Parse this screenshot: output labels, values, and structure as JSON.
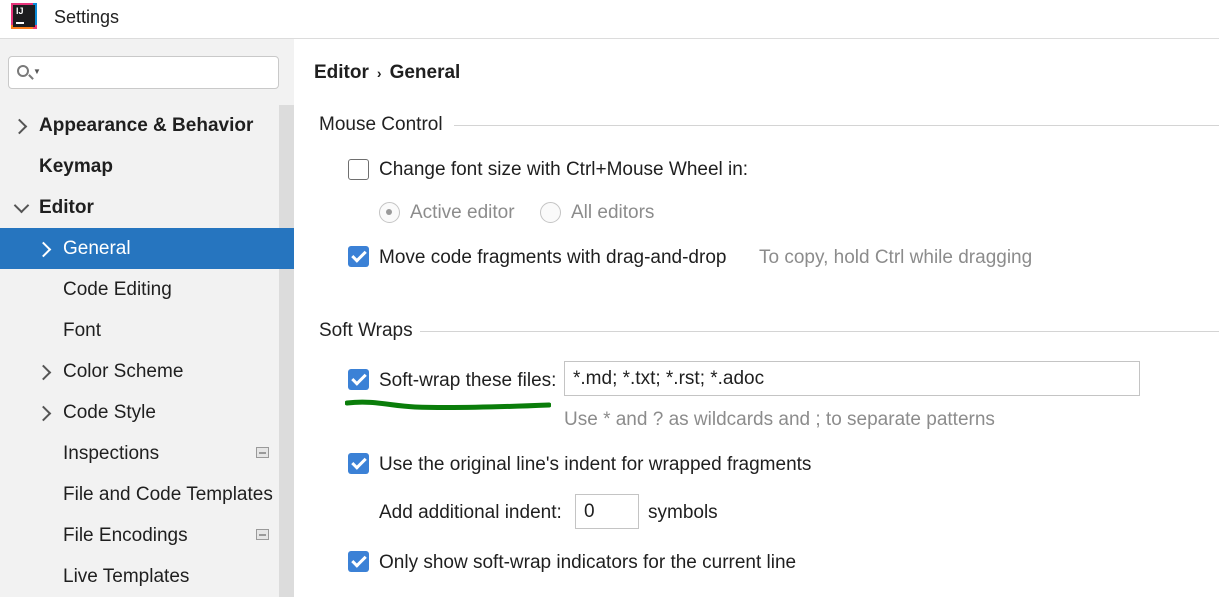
{
  "window": {
    "title": "Settings"
  },
  "sidebar": {
    "search_placeholder": "",
    "items": [
      {
        "label": "Appearance & Behavior"
      },
      {
        "label": "Keymap"
      },
      {
        "label": "Editor"
      },
      {
        "label": "General"
      },
      {
        "label": "Code Editing"
      },
      {
        "label": "Font"
      },
      {
        "label": "Color Scheme"
      },
      {
        "label": "Code Style"
      },
      {
        "label": "Inspections"
      },
      {
        "label": "File and Code Templates"
      },
      {
        "label": "File Encodings"
      },
      {
        "label": "Live Templates"
      }
    ]
  },
  "breadcrumb": {
    "parent": "Editor",
    "current": "General"
  },
  "mouse_control": {
    "title": "Mouse Control",
    "font_size_label": "Change font size with Ctrl+Mouse Wheel in:",
    "font_size_checked": false,
    "radio_active": "Active editor",
    "radio_all": "All editors",
    "drag_drop_label": "Move code fragments with drag-and-drop",
    "drag_drop_checked": true,
    "drag_drop_hint": "To copy, hold Ctrl while dragging"
  },
  "soft_wraps": {
    "title": "Soft Wraps",
    "files_label": "Soft-wrap these files:",
    "files_checked": true,
    "files_value": "*.md; *.txt; *.rst; *.adoc",
    "files_hint": "Use * and ? as wildcards and ; to separate patterns",
    "indent_label": "Use the original line's indent for wrapped fragments",
    "indent_checked": true,
    "additional_label": "Add additional indent:",
    "additional_value": "0",
    "symbols_label": "symbols",
    "indicators_label": "Only show soft-wrap indicators for the current line",
    "indicators_checked": true
  },
  "colors": {
    "selection": "#2675bf",
    "checkbox": "#3b81d6",
    "annotation": "#0a7d0a"
  }
}
